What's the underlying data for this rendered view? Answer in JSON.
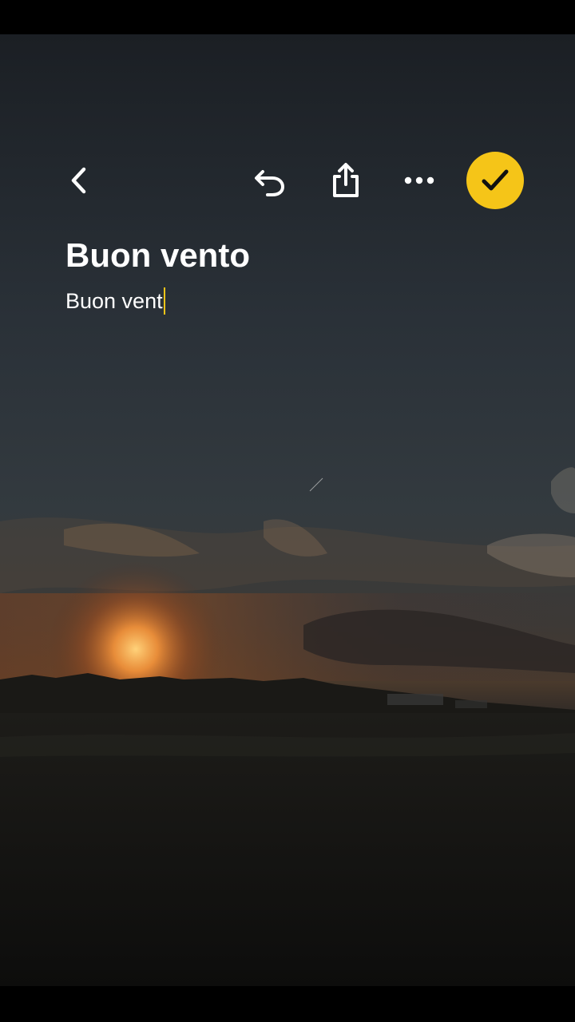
{
  "toolbar": {
    "back_icon": "chevron-left-icon",
    "undo_icon": "undo-icon",
    "share_icon": "share-icon",
    "more_icon": "ellipsis-icon",
    "done_icon": "checkmark-icon"
  },
  "note": {
    "title": "Buon vento",
    "body": "Buon vent"
  },
  "colors": {
    "accent": "#f5c518",
    "text": "#ffffff",
    "background": "#000000"
  },
  "wallpaper": {
    "description_icon": "sunset-landscape-image"
  }
}
